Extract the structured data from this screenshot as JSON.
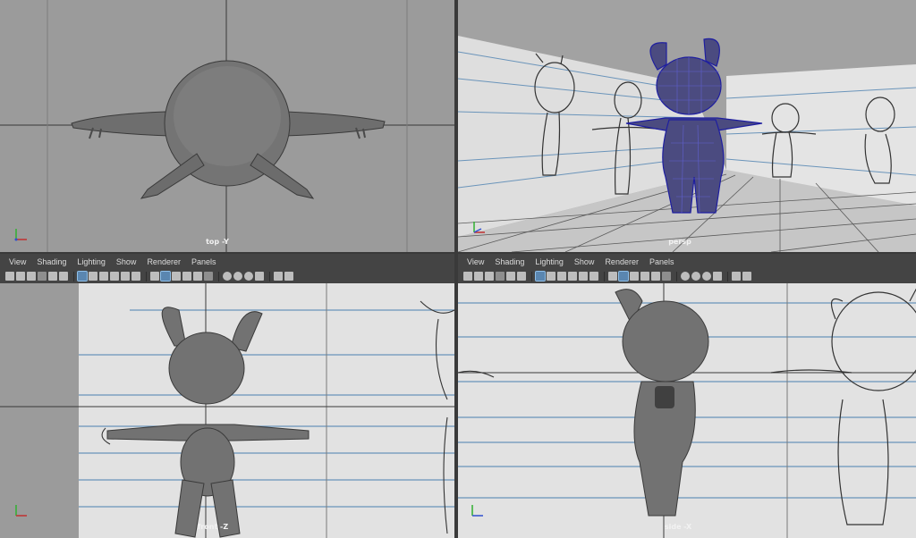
{
  "viewports": [
    {
      "id": "top",
      "label": "top -Y",
      "menu": null
    },
    {
      "id": "persp",
      "label": "persp",
      "menu": null
    },
    {
      "id": "front",
      "label": "front -Z",
      "menu": [
        "View",
        "Shading",
        "Lighting",
        "Show",
        "Renderer",
        "Panels"
      ]
    },
    {
      "id": "side",
      "label": "side -X",
      "menu": [
        "View",
        "Shading",
        "Lighting",
        "Show",
        "Renderer",
        "Panels"
      ]
    }
  ],
  "menus": {
    "left": {
      "view": "View",
      "shading": "Shading",
      "lighting": "Lighting",
      "show": "Show",
      "renderer": "Renderer",
      "panels": "Panels"
    },
    "right": {
      "view": "View",
      "shading": "Shading",
      "lighting": "Lighting",
      "show": "Show",
      "renderer": "Renderer",
      "panels": "Panels"
    }
  },
  "labels": {
    "top": "top -Y",
    "persp": "persp",
    "front": "front -Z",
    "side": "side -X"
  },
  "colors": {
    "viewport_bg_top": "#9c9c9c",
    "viewport_bg_persp": "#a0a0a0",
    "grid_line": "#2f2f2f",
    "wireframe_selected": "#2a2aa8",
    "model_shade": "#7a7a7a",
    "toolbar_active": "#5a86b0",
    "axis_x": "#c03030",
    "axis_y": "#30b030",
    "axis_z": "#3050d0"
  },
  "toolbar_icons": [
    "camera-icon",
    "camera-attributes-icon",
    "bookmark-icon",
    "image-plane-icon",
    "2d-pan-zoom-icon",
    "grease-pencil-icon",
    "grid-toggle-icon",
    "film-gate-icon",
    "resolution-gate-icon",
    "gate-mask-icon",
    "field-chart-icon",
    "safe-action-icon",
    "wireframe-icon",
    "smooth-shade-icon",
    "wireframe-on-shaded-icon",
    "textured-icon",
    "lights-icon",
    "shadows-icon",
    "screen-space-ao-icon",
    "motion-blur-icon",
    "isolate-select-icon",
    "xray-icon",
    "xray-joints-icon",
    "backface-culling-icon"
  ]
}
